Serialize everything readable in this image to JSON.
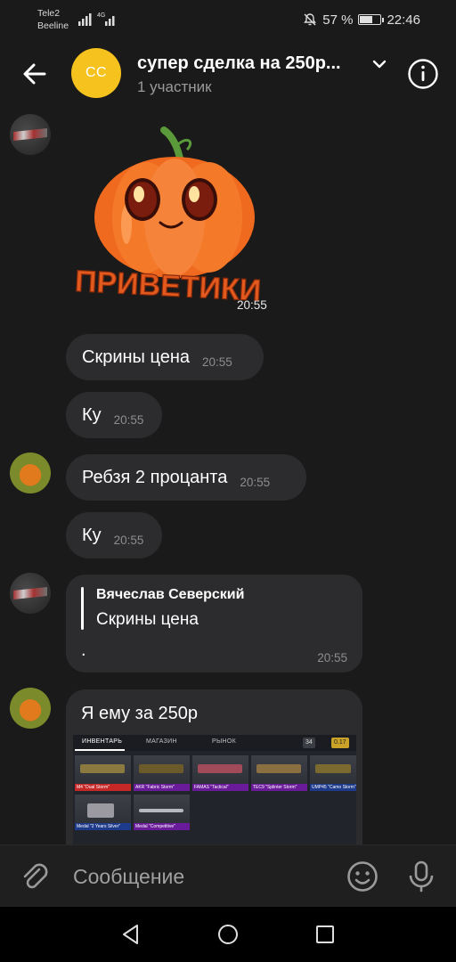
{
  "status_bar": {
    "carrier1": "Tele2",
    "carrier2": "Beeline",
    "network": "4G",
    "battery": "57 %",
    "time": "22:46",
    "icons": [
      "signal-icon",
      "mute-icon",
      "battery-icon"
    ]
  },
  "header": {
    "avatar_initials": "СС",
    "avatar_color": "#f6c21d",
    "title": "супер сделка на 250р...",
    "subtitle": "1 участник"
  },
  "messages": [
    {
      "sticker_text": "ПРИВЕТИКИ",
      "time": "20:55"
    },
    {
      "text": "Скрины цена",
      "time": "20:55"
    },
    {
      "text": "Ку",
      "time": "20:55"
    },
    {
      "text": "Ребзя 2 процанта",
      "time": "20:55"
    },
    {
      "text": "Ку",
      "time": "20:55"
    },
    {
      "reply_author": "Вячеслав Северский",
      "reply_text": "Скрины цена",
      "text": ".",
      "time": "20:55"
    },
    {
      "text": "Я ему за 250р"
    }
  ],
  "screenshot": {
    "tabs": [
      "ИНВЕНТАРЬ",
      "МАГАЗИН",
      "РЫНОК"
    ],
    "chip1": "34",
    "chip2": "0.17",
    "items": [
      {
        "name": "M4 \"Dual Storm\"",
        "color": "#c62828"
      },
      {
        "name": "AKR \"Fabric Storm\"",
        "color": "#6a1b9a"
      },
      {
        "name": "FAMAS \"Tactical\"",
        "color": "#6a1b9a"
      },
      {
        "name": "TEC9 \"Splinter Storm\"",
        "color": "#6a1b9a"
      },
      {
        "name": "UMP45 \"Camo Storm\"",
        "color": "#1e3a8a"
      },
      {
        "name": "Medal \"2 Years Silver\"",
        "color": "#1e3a8a"
      },
      {
        "name": "Medal \"Competitive\"",
        "color": "#6a1b9a"
      }
    ]
  },
  "composer": {
    "placeholder": "Сообщение"
  }
}
